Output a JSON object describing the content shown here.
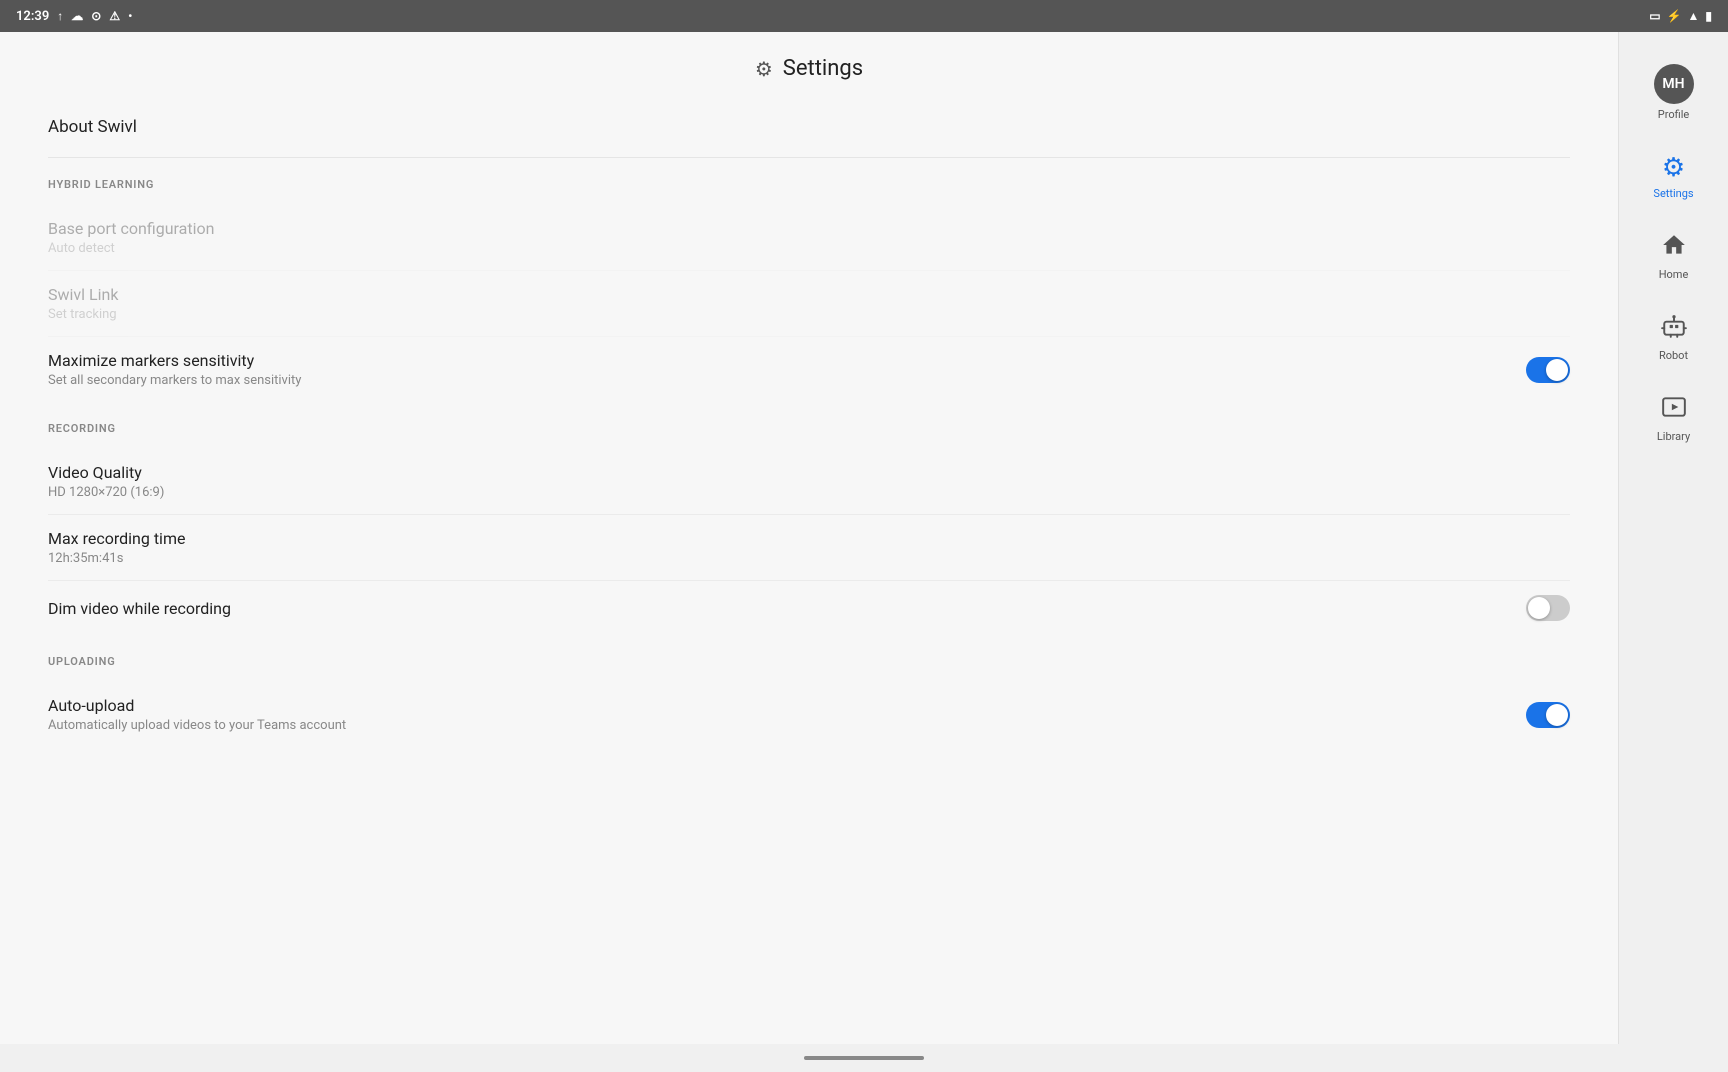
{
  "statusBar": {
    "time": "12:39",
    "icons": [
      "upload-icon",
      "cloud-icon",
      "clock-icon",
      "warning-icon",
      "dot-icon"
    ],
    "rightIcons": [
      "cast-icon",
      "bluetooth-icon",
      "wifi-icon",
      "battery-icon"
    ]
  },
  "header": {
    "title": "Settings",
    "gearSymbol": "⚙"
  },
  "about": {
    "label": "About Swivl"
  },
  "sections": [
    {
      "id": "hybrid-learning",
      "heading": "HYBRID LEARNING",
      "items": [
        {
          "id": "base-port-config",
          "title": "Base port configuration",
          "subtitle": "Auto detect",
          "faded": true,
          "control": "none"
        },
        {
          "id": "swivl-link",
          "title": "Swivl Link",
          "subtitle": "Set tracking",
          "faded": true,
          "control": "none"
        },
        {
          "id": "maximize-markers",
          "title": "Maximize markers sensitivity",
          "subtitle": "Set all secondary markers to max sensitivity",
          "faded": false,
          "control": "toggle",
          "toggleOn": true
        }
      ]
    },
    {
      "id": "recording",
      "heading": "RECORDING",
      "items": [
        {
          "id": "video-quality",
          "title": "Video Quality",
          "subtitle": "HD 1280×720 (16:9)",
          "faded": false,
          "control": "none"
        },
        {
          "id": "max-recording-time",
          "title": "Max recording time",
          "subtitle": "12h:35m:41s",
          "faded": false,
          "control": "none"
        },
        {
          "id": "dim-video",
          "title": "Dim video while recording",
          "subtitle": "",
          "faded": false,
          "control": "toggle",
          "toggleOn": false
        }
      ]
    },
    {
      "id": "uploading",
      "heading": "UPLOADING",
      "items": [
        {
          "id": "auto-upload",
          "title": "Auto-upload",
          "subtitle": "Automatically upload videos to your Teams account",
          "faded": false,
          "control": "toggle",
          "toggleOn": true
        }
      ]
    }
  ],
  "sidebar": {
    "items": [
      {
        "id": "profile",
        "label": "Profile",
        "icon": "avatar",
        "initials": "MH",
        "active": false
      },
      {
        "id": "settings",
        "label": "Settings",
        "icon": "⚙",
        "active": true
      },
      {
        "id": "home",
        "label": "Home",
        "icon": "🏠",
        "active": false
      },
      {
        "id": "robot",
        "label": "Robot",
        "icon": "robot",
        "active": false
      },
      {
        "id": "library",
        "label": "Library",
        "icon": "library",
        "active": false
      }
    ]
  }
}
